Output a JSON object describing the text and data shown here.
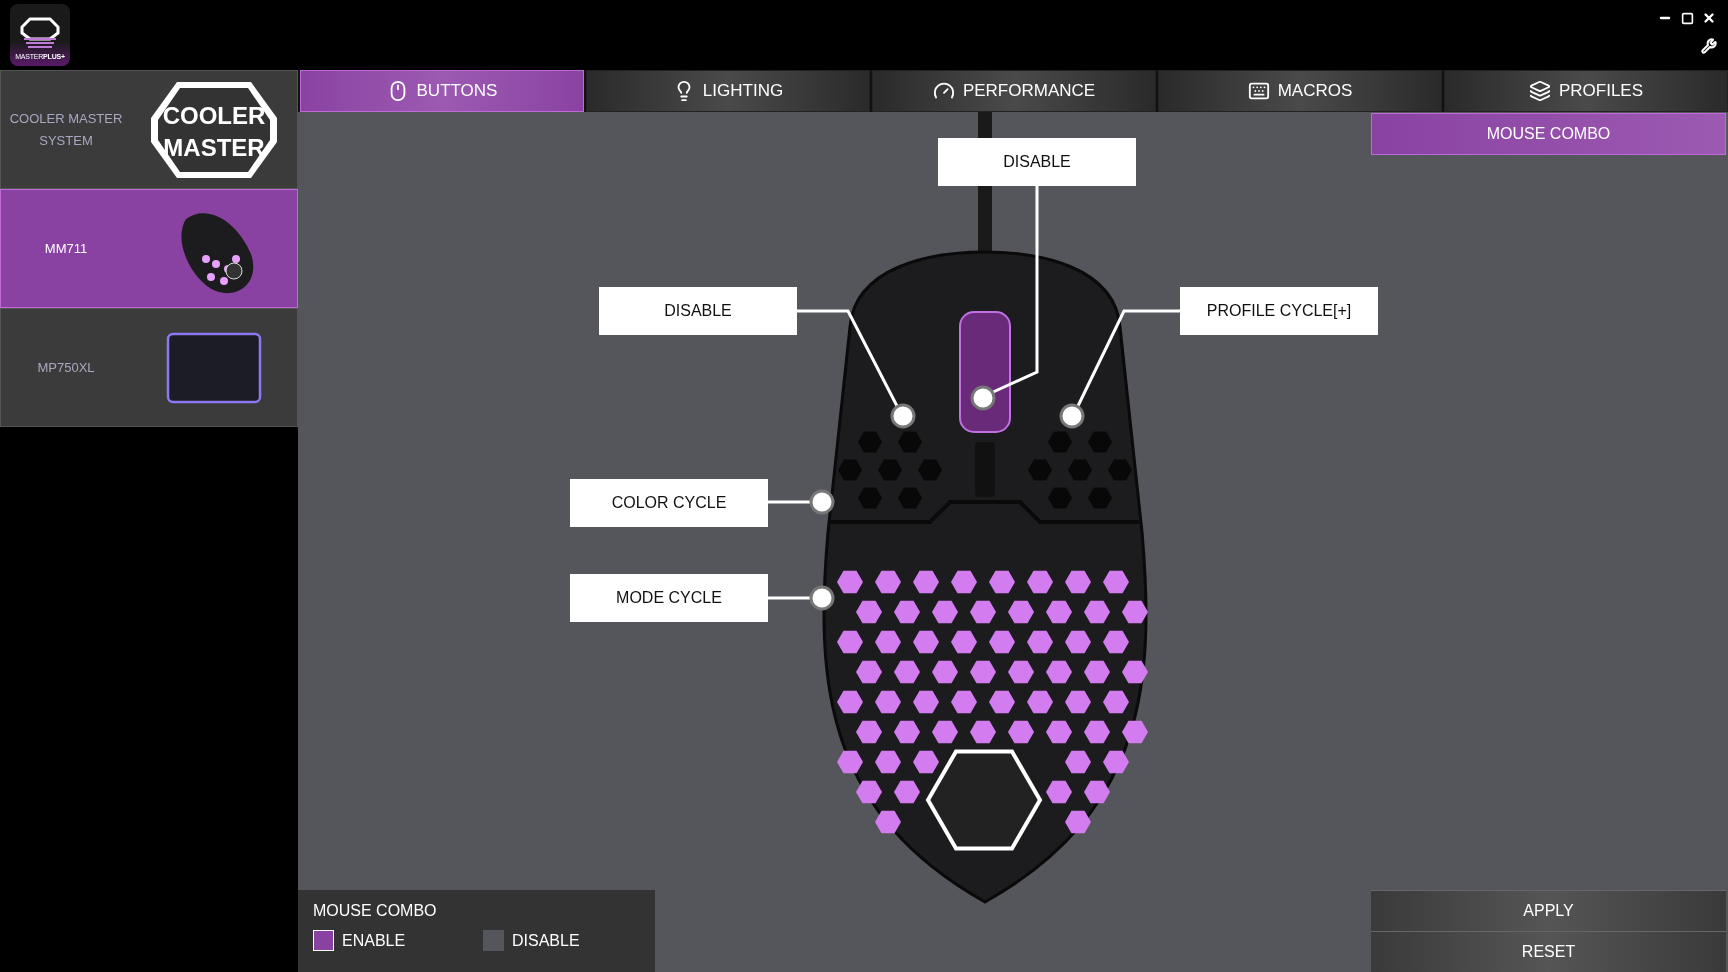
{
  "app_logo": {
    "text": "MASTER**PLUS+**"
  },
  "sidebar": {
    "items": [
      {
        "kind": "brand",
        "label": "COOLER MASTER SYSTEM",
        "logo_lines": [
          "COOLER",
          "MASTER"
        ],
        "selected": false
      },
      {
        "kind": "mouse",
        "label": "MM711",
        "selected": true
      },
      {
        "kind": "mousepad",
        "label": "MP750XL",
        "selected": false
      }
    ]
  },
  "tabs": [
    {
      "label": "BUTTONS",
      "selected": true
    },
    {
      "label": "LIGHTING",
      "selected": false
    },
    {
      "label": "PERFORMANCE",
      "selected": false
    },
    {
      "label": "MACROS",
      "selected": false
    },
    {
      "label": "PROFILES",
      "selected": false
    }
  ],
  "mouse_combo_button": {
    "label": "MOUSE COMBO",
    "selected": true
  },
  "assignments": [
    {
      "label": "DISABLE"
    },
    {
      "label": "DISABLE"
    },
    {
      "label": "PROFILE CYCLE[+]"
    },
    {
      "label": "COLOR CYCLE"
    },
    {
      "label": "MODE CYCLE"
    }
  ],
  "mouse_combo_panel": {
    "title": "MOUSE COMBO",
    "options": [
      {
        "label": "ENABLE",
        "selected": true
      },
      {
        "label": "DISABLE",
        "selected": false
      }
    ]
  },
  "actions": [
    "APPLY",
    "RESET"
  ]
}
